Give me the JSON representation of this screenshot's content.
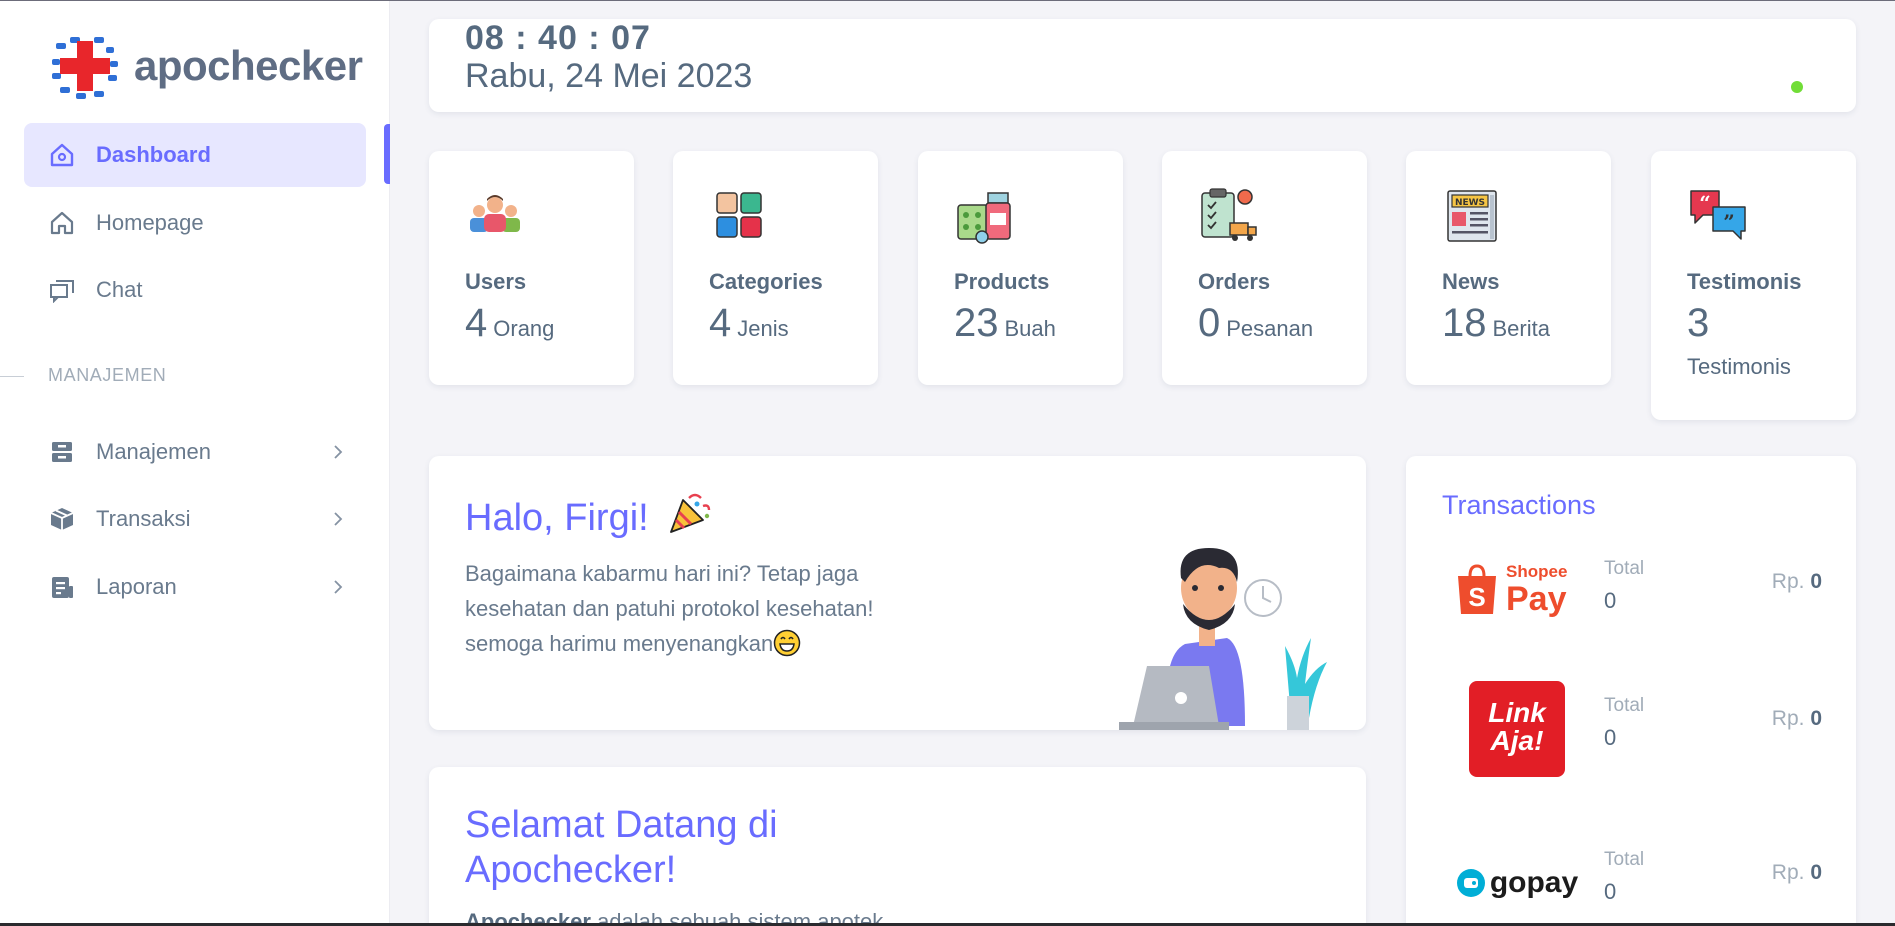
{
  "app": {
    "name": "apochecker"
  },
  "sidebar": {
    "items": [
      {
        "label": "Dashboard"
      },
      {
        "label": "Homepage"
      },
      {
        "label": "Chat"
      }
    ],
    "section_heading": "MANAJEMEN",
    "groups": [
      {
        "label": "Manajemen"
      },
      {
        "label": "Transaksi"
      },
      {
        "label": "Laporan"
      }
    ]
  },
  "header": {
    "time": "08 : 40 : 07",
    "date": "Rabu, 24 Mei 2023",
    "status_color": "#71dd37"
  },
  "stats": [
    {
      "label": "Users",
      "value": "4",
      "unit": "Orang",
      "icon": "users-icon"
    },
    {
      "label": "Categories",
      "value": "4",
      "unit": "Jenis",
      "icon": "categories-icon"
    },
    {
      "label": "Products",
      "value": "23",
      "unit": "Buah",
      "icon": "products-icon"
    },
    {
      "label": "Orders",
      "value": "0",
      "unit": "Pesanan",
      "icon": "orders-icon"
    },
    {
      "label": "News",
      "value": "18",
      "unit": "Berita",
      "icon": "news-icon"
    },
    {
      "label": "Testimonis",
      "value": "3",
      "unit": "Testimonis",
      "icon": "testimonis-icon"
    }
  ],
  "welcome": {
    "title": "Halo, Firgi!",
    "message": "Bagaimana kabarmu hari ini? Tetap jaga kesehatan dan patuhi protokol kesehatan! semoga harimu menyenangkan"
  },
  "about": {
    "title": "Selamat Datang di Apochecker!",
    "lead": "Apochecker",
    "text": " adalah sebuah sistem apotek"
  },
  "transactions": {
    "title": "Transactions",
    "rows": [
      {
        "method": "ShopeePay",
        "logo_top": "Shopee",
        "logo_bottom": "Pay",
        "total_label": "Total",
        "total": "0",
        "currency": "Rp.",
        "amount": "0"
      },
      {
        "method": "LinkAja",
        "logo_top": "Link",
        "logo_bottom": "Aja!",
        "total_label": "Total",
        "total": "0",
        "currency": "Rp.",
        "amount": "0"
      },
      {
        "method": "gopay",
        "logo_text": "gopay",
        "total_label": "Total",
        "total": "0",
        "currency": "Rp.",
        "amount": "0"
      }
    ]
  },
  "colors": {
    "accent": "#696cff",
    "accent_bg": "#e7e7ff",
    "text": "#566a7f",
    "muted": "#a1acb8"
  }
}
